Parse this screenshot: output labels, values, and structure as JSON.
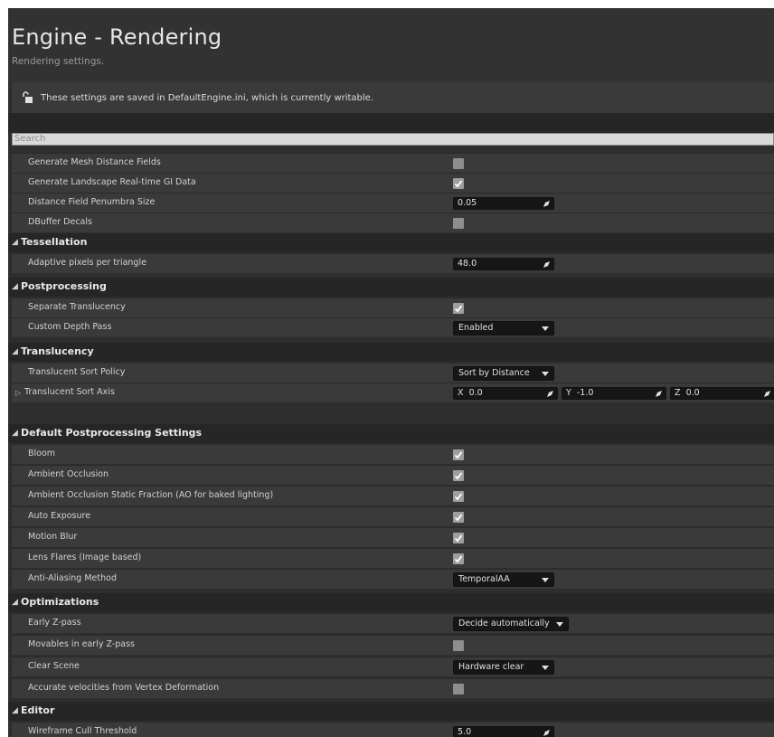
{
  "header": {
    "title": "Engine - Rendering",
    "subtitle": "Rendering settings."
  },
  "notice": {
    "text": "These settings are saved in DefaultEngine.ini, which is currently writable.",
    "icon": "unlock-icon"
  },
  "search": {
    "placeholder": "Search",
    "value": ""
  },
  "rows": {
    "gen_mesh_df": {
      "label": "Generate Mesh Distance Fields",
      "checked": false
    },
    "gen_landscape_gi": {
      "label": "Generate Landscape Real-time GI Data",
      "checked": true
    },
    "df_penumbra": {
      "label": "Distance Field Penumbra Size",
      "value": "0.05"
    },
    "dbuffer": {
      "label": "DBuffer Decals",
      "checked": false
    }
  },
  "categories": {
    "tessellation": "Tessellation",
    "postprocessing": "Postprocessing",
    "translucency": "Translucency",
    "default_pp": "Default Postprocessing Settings",
    "optimizations": "Optimizations",
    "editor": "Editor"
  },
  "tessellation": {
    "adaptive": {
      "label": "Adaptive pixels per triangle",
      "value": "48.0"
    }
  },
  "postprocessing": {
    "sep_trans": {
      "label": "Separate Translucency",
      "checked": true
    },
    "custom_depth": {
      "label": "Custom Depth Pass",
      "value": "Enabled"
    }
  },
  "translucency": {
    "sort_policy": {
      "label": "Translucent Sort Policy",
      "value": "Sort by Distance"
    },
    "sort_axis": {
      "label": "Translucent Sort Axis",
      "x_label": "X",
      "x": "0.0",
      "y_label": "Y",
      "y": "-1.0",
      "z_label": "Z",
      "z": "0.0"
    }
  },
  "default_pp": {
    "bloom": {
      "label": "Bloom",
      "checked": true
    },
    "ao": {
      "label": "Ambient Occlusion",
      "checked": true
    },
    "ao_static": {
      "label": "Ambient Occlusion Static Fraction (AO for baked lighting)",
      "checked": true
    },
    "auto_exposure": {
      "label": "Auto Exposure",
      "checked": true
    },
    "motion_blur": {
      "label": "Motion Blur",
      "checked": true
    },
    "lens_flares": {
      "label": "Lens Flares (Image based)",
      "checked": true
    },
    "aa_method": {
      "label": "Anti-Aliasing Method",
      "value": "TemporalAA"
    }
  },
  "optimizations": {
    "early_z": {
      "label": "Early Z-pass",
      "value": "Decide automatically"
    },
    "movables_z": {
      "label": "Movables in early Z-pass",
      "checked": false
    },
    "clear_scene": {
      "label": "Clear Scene",
      "value": "Hardware clear"
    },
    "accurate_vel": {
      "label": "Accurate velocities from Vertex Deformation",
      "checked": false
    }
  },
  "editor": {
    "wire_cull": {
      "label": "Wireframe Cull Threshold",
      "value": "5.0"
    }
  },
  "colors": {
    "panel": "#2e2e2e",
    "row": "#3a3a3a",
    "category": "#262626",
    "field": "#161616",
    "checkbox": "#9e9e9e"
  }
}
